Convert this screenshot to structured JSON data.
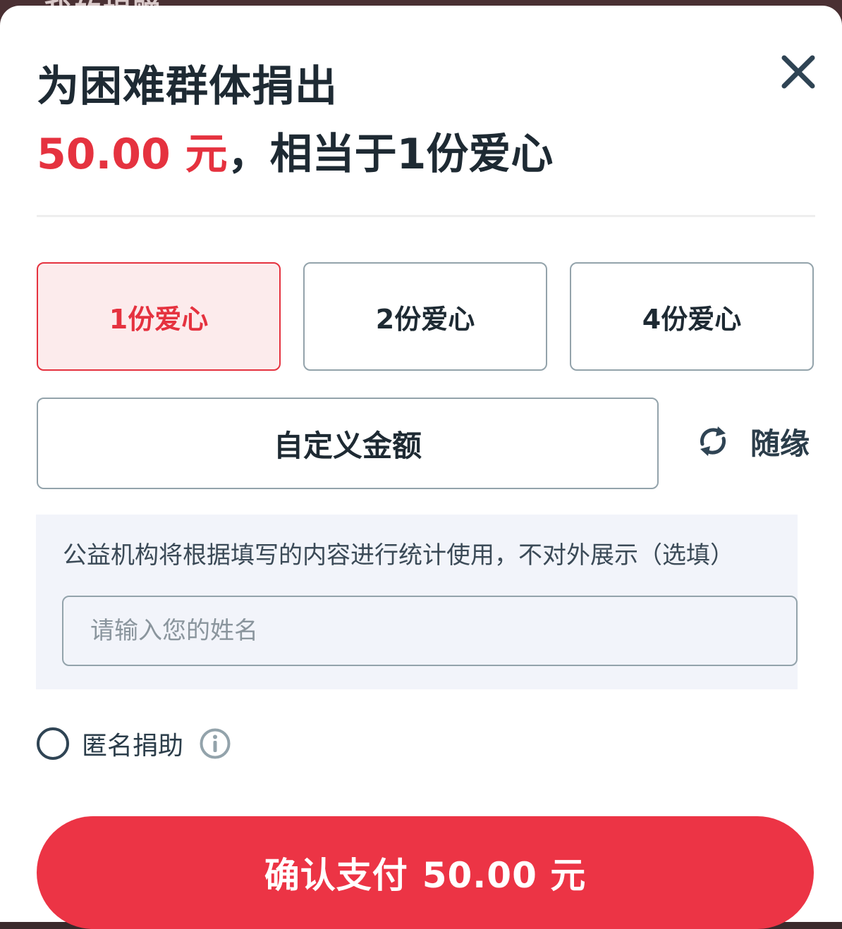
{
  "background": {
    "page_title_partial": "我的捐赠"
  },
  "header": {
    "title": "为困难群体捐出",
    "amount": "50.00 元",
    "equivalent_text": "，相当于1份爱心"
  },
  "options": [
    {
      "label": "1份爱心",
      "selected": true
    },
    {
      "label": "2份爱心",
      "selected": false
    },
    {
      "label": "4份爱心",
      "selected": false
    }
  ],
  "custom_amount": {
    "label": "自定义金额"
  },
  "random": {
    "icon": "refresh-icon",
    "label": "随缘"
  },
  "info": {
    "text": "公益机构将根据填写的内容进行统计使用，不对外展示（选填）",
    "name_input": {
      "placeholder": "请输入您的姓名",
      "value": ""
    }
  },
  "anonymous": {
    "label": "匿名捐助",
    "checked": false,
    "info_icon": "info-icon"
  },
  "pay_button": {
    "label": "确认支付",
    "amount": "50.00 元"
  },
  "colors": {
    "accent_red": "#e5323f",
    "pay_button": "#ec3445",
    "selected_bg": "#fcebec",
    "text_dark": "#1e2a33",
    "border_gray": "#93a3ab",
    "panel_bg": "#f2f4fa"
  }
}
